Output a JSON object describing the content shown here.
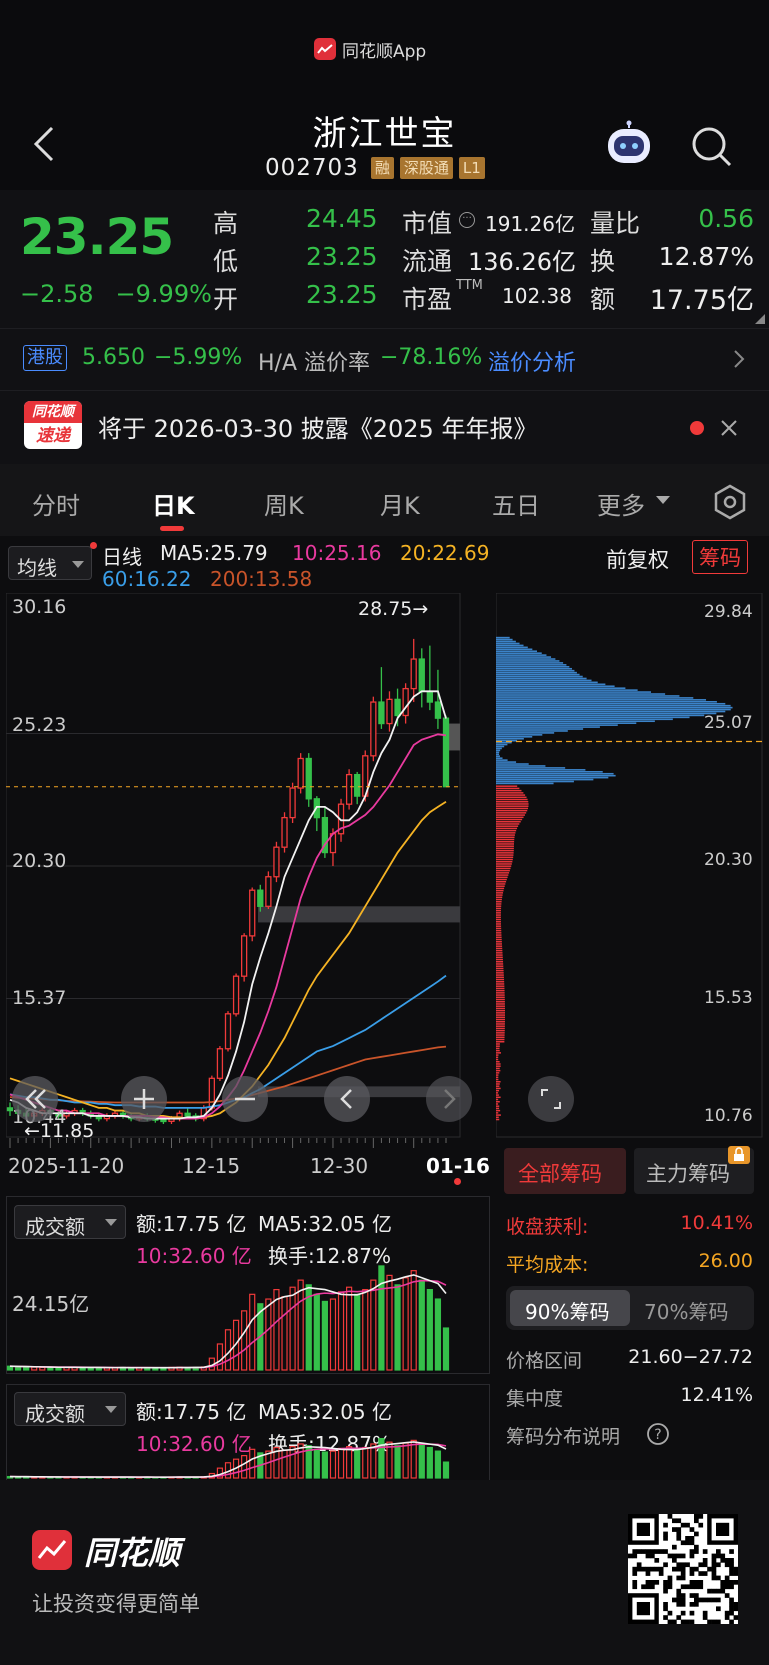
{
  "app": {
    "name": "同花顺App"
  },
  "stock": {
    "name": "浙江世宝",
    "code": "002703",
    "tags": [
      "融",
      "深股通",
      "L1"
    ]
  },
  "quote": {
    "price": "23.25",
    "change": "−2.58",
    "change_pct": "−9.99%",
    "high_label": "高",
    "high": "24.45",
    "low_label": "低",
    "low": "23.25",
    "open_label": "开",
    "open": "23.25",
    "mcap_label": "市值",
    "mcap": "191.26亿",
    "float_label": "流通",
    "float": "136.26亿",
    "pe_label": "市盈",
    "pe_sup": "TTM",
    "pe": "102.38",
    "vr_label": "量比",
    "vr": "0.56",
    "turn_label": "换",
    "turn": "12.87%",
    "amt_label": "额",
    "amt": "17.75亿"
  },
  "hk": {
    "badge": "港股",
    "price": "5.650",
    "pct": "−5.99%",
    "premium_label": "H/A 溢价率",
    "premium": "−78.16%",
    "link": "溢价分析"
  },
  "notice": {
    "logo_top": "同花顺",
    "logo_bottom": "速递",
    "text": "将于 2026-03-30 披露《2025 年年报》"
  },
  "tabs": [
    "分时",
    "日K",
    "周K",
    "月K",
    "五日",
    "更多"
  ],
  "chart": {
    "ma_button": "均线",
    "label": "日线",
    "ma5": "MA5:25.79",
    "ma10": "10:25.16",
    "ma20": "20:22.69",
    "ma60": "60:16.22",
    "ma200": "200:13.58",
    "adjust": "前复权",
    "chips_button": "筹码",
    "y_ticks": [
      "30.16",
      "25.23",
      "20.30",
      "15.37",
      "10.44"
    ],
    "max_label": "28.75→",
    "min_label": "←11.85",
    "x_ticks": [
      "2025-11-20",
      "12-15",
      "12-30",
      "01-16"
    ],
    "chip_ticks": [
      "29.84",
      "25.07",
      "20.30",
      "15.53",
      "10.76"
    ]
  },
  "chart_data": {
    "type": "candlestick",
    "ylim": [
      10.44,
      30.16
    ],
    "candles": [
      [
        11.3,
        11.5,
        11.0,
        11.2
      ],
      [
        11.2,
        11.4,
        11.0,
        11.1
      ],
      [
        11.1,
        11.3,
        10.9,
        11.0
      ],
      [
        11.0,
        11.2,
        10.9,
        11.1
      ],
      [
        11.1,
        11.3,
        11.0,
        11.2
      ],
      [
        11.2,
        11.3,
        11.0,
        11.1
      ],
      [
        11.1,
        11.2,
        10.9,
        11.0
      ],
      [
        11.0,
        11.2,
        10.9,
        11.1
      ],
      [
        11.1,
        11.3,
        11.0,
        11.2
      ],
      [
        11.2,
        11.3,
        11.0,
        11.1
      ],
      [
        11.1,
        11.2,
        10.9,
        11.0
      ],
      [
        11.0,
        11.1,
        10.8,
        10.9
      ],
      [
        10.9,
        11.1,
        10.8,
        11.0
      ],
      [
        11.0,
        11.2,
        10.9,
        11.1
      ],
      [
        11.1,
        11.2,
        10.9,
        11.0
      ],
      [
        11.0,
        11.1,
        10.8,
        10.9
      ],
      [
        10.9,
        11.0,
        10.8,
        10.95
      ],
      [
        10.95,
        11.1,
        10.8,
        10.9
      ],
      [
        10.9,
        11.0,
        10.75,
        10.85
      ],
      [
        10.85,
        11.0,
        10.7,
        10.8
      ],
      [
        10.8,
        11.0,
        10.7,
        10.95
      ],
      [
        10.95,
        11.2,
        10.8,
        11.1
      ],
      [
        11.1,
        11.3,
        10.9,
        11.0
      ],
      [
        11.0,
        11.1,
        10.8,
        10.9
      ],
      [
        10.9,
        11.4,
        10.8,
        11.3
      ],
      [
        11.3,
        12.5,
        11.2,
        12.4
      ],
      [
        12.4,
        13.6,
        12.3,
        13.5
      ],
      [
        13.5,
        14.9,
        13.4,
        14.8
      ],
      [
        14.8,
        16.3,
        14.7,
        16.2
      ],
      [
        16.2,
        17.8,
        16.0,
        17.7
      ],
      [
        17.7,
        19.5,
        17.5,
        19.4
      ],
      [
        19.4,
        19.6,
        18.6,
        18.8
      ],
      [
        18.8,
        20.1,
        18.7,
        19.9
      ],
      [
        19.9,
        21.2,
        19.7,
        21.0
      ],
      [
        21.0,
        22.3,
        20.8,
        22.1
      ],
      [
        22.1,
        23.4,
        21.9,
        23.2
      ],
      [
        23.2,
        24.5,
        23.0,
        24.3
      ],
      [
        24.3,
        24.5,
        22.5,
        22.8
      ],
      [
        22.8,
        22.9,
        21.6,
        22.1
      ],
      [
        22.1,
        22.5,
        20.6,
        20.8
      ],
      [
        20.8,
        21.7,
        20.3,
        21.5
      ],
      [
        21.5,
        22.8,
        21.2,
        22.6
      ],
      [
        22.6,
        23.9,
        22.4,
        23.7
      ],
      [
        23.7,
        23.8,
        22.6,
        22.9
      ],
      [
        22.9,
        24.6,
        22.7,
        24.4
      ],
      [
        24.4,
        26.6,
        24.2,
        26.4
      ],
      [
        26.4,
        27.7,
        25.4,
        25.6
      ],
      [
        25.6,
        26.8,
        25.3,
        26.5
      ],
      [
        26.5,
        26.9,
        25.5,
        25.9
      ],
      [
        25.9,
        27.1,
        25.6,
        26.9
      ],
      [
        26.9,
        28.75,
        26.4,
        28.0
      ],
      [
        28.0,
        28.4,
        26.2,
        26.8
      ],
      [
        26.8,
        28.5,
        26.1,
        26.4
      ],
      [
        26.4,
        27.6,
        25.4,
        25.8
      ],
      [
        25.8,
        25.9,
        23.25,
        23.25
      ]
    ],
    "ma5": [
      11.6,
      11.5,
      11.3,
      11.2,
      11.1,
      11.1,
      11.1,
      11.1,
      11.1,
      11.1,
      11.0,
      11.0,
      11.0,
      11.0,
      11.0,
      10.95,
      10.95,
      10.9,
      10.9,
      10.9,
      10.9,
      10.9,
      10.95,
      10.95,
      11.0,
      11.3,
      11.8,
      12.5,
      13.4,
      14.5,
      15.9,
      16.9,
      17.8,
      18.8,
      19.9,
      20.6,
      21.3,
      22.0,
      22.5,
      22.5,
      22.3,
      22.0,
      22.0,
      22.3,
      22.9,
      23.8,
      24.5,
      25.0,
      25.8,
      26.2,
      26.6,
      26.8,
      26.8,
      26.8,
      25.79
    ],
    "ma10": [
      11.8,
      11.7,
      11.6,
      11.5,
      11.4,
      11.3,
      11.2,
      11.2,
      11.1,
      11.1,
      11.1,
      11.1,
      11.0,
      11.0,
      11.0,
      11.0,
      11.0,
      11.0,
      10.95,
      10.95,
      10.9,
      10.9,
      10.9,
      10.9,
      10.95,
      11.1,
      11.35,
      11.7,
      12.1,
      12.7,
      13.4,
      14.1,
      14.9,
      15.8,
      16.9,
      18.0,
      19.1,
      19.9,
      20.6,
      21.1,
      21.5,
      21.7,
      21.8,
      22.0,
      22.2,
      22.5,
      22.9,
      23.3,
      23.8,
      24.3,
      24.8,
      25.0,
      25.1,
      25.2,
      25.16
    ],
    "ma20": [
      12.4,
      12.3,
      12.2,
      12.1,
      12.0,
      11.9,
      11.8,
      11.7,
      11.6,
      11.5,
      11.4,
      11.3,
      11.3,
      11.2,
      11.2,
      11.1,
      11.1,
      11.0,
      11.0,
      11.0,
      10.95,
      10.95,
      10.9,
      10.9,
      10.95,
      11.0,
      11.1,
      11.3,
      11.5,
      11.8,
      12.1,
      12.5,
      12.9,
      13.4,
      13.9,
      14.5,
      15.1,
      15.7,
      16.2,
      16.6,
      17.0,
      17.4,
      17.8,
      18.3,
      18.8,
      19.3,
      19.8,
      20.3,
      20.8,
      21.2,
      21.6,
      22.0,
      22.3,
      22.5,
      22.69
    ],
    "ma60": [
      11.8,
      11.75,
      11.7,
      11.7,
      11.65,
      11.6,
      11.6,
      11.55,
      11.5,
      11.5,
      11.5,
      11.45,
      11.45,
      11.4,
      11.4,
      11.4,
      11.35,
      11.35,
      11.35,
      11.3,
      11.3,
      11.3,
      11.3,
      11.3,
      11.3,
      11.35,
      11.4,
      11.5,
      11.6,
      11.7,
      11.85,
      12.0,
      12.2,
      12.4,
      12.6,
      12.8,
      13.0,
      13.2,
      13.4,
      13.5,
      13.6,
      13.75,
      13.9,
      14.05,
      14.2,
      14.4,
      14.6,
      14.8,
      15.0,
      15.2,
      15.4,
      15.6,
      15.8,
      16.0,
      16.22
    ],
    "ma200": [
      11.7,
      11.68,
      11.66,
      11.64,
      11.62,
      11.6,
      11.58,
      11.56,
      11.55,
      11.54,
      11.53,
      11.52,
      11.51,
      11.5,
      11.5,
      11.5,
      11.5,
      11.5,
      11.5,
      11.5,
      11.5,
      11.5,
      11.5,
      11.5,
      11.5,
      11.52,
      11.55,
      11.6,
      11.65,
      11.7,
      11.78,
      11.86,
      11.94,
      12.02,
      12.1,
      12.2,
      12.3,
      12.4,
      12.5,
      12.6,
      12.7,
      12.8,
      12.9,
      13.0,
      13.1,
      13.15,
      13.2,
      13.25,
      13.3,
      13.35,
      13.4,
      13.45,
      13.5,
      13.55,
      13.58
    ],
    "last_close": 23.25
  },
  "chips": {
    "tab_all": "全部筹码",
    "tab_main": "主力筹码",
    "profit_label": "收盘获利:",
    "profit": "10.41%",
    "cost_label": "平均成本:",
    "cost": "26.00",
    "seg_90": "90%筹码",
    "seg_70": "70%筹码",
    "range_label": "价格区间",
    "range": "21.60−27.72",
    "conc_label": "集中度",
    "conc": "12.41%",
    "desc": "筹码分布说明"
  },
  "volume": {
    "panel_label": "成交额",
    "amt": "额:17.75 亿",
    "ma5": "MA5:32.05 亿",
    "ma10": "10:32.60 亿",
    "turnover": "换手:12.87%",
    "y_tick": "24.15亿",
    "values": [
      1.6,
      1.4,
      1.3,
      1.2,
      1.1,
      1.2,
      1.0,
      1.1,
      1.2,
      1.0,
      1.1,
      1.0,
      0.9,
      1.0,
      1.1,
      1.0,
      0.9,
      1.0,
      0.9,
      1.0,
      1.1,
      1.2,
      1.0,
      1.1,
      1.3,
      5.0,
      11.0,
      17.0,
      21.0,
      25.0,
      32.0,
      28.0,
      30.0,
      34.0,
      31.0,
      35.0,
      38.0,
      36.0,
      32.0,
      29.0,
      30.0,
      33.0,
      35.0,
      32.0,
      34.0,
      38.0,
      44.0,
      40.0,
      36.0,
      39.0,
      42.0,
      38.0,
      34.0,
      30.0,
      17.75
    ]
  },
  "footer": {
    "brand": "同花顺",
    "slogan": "让投资变得更简单"
  }
}
